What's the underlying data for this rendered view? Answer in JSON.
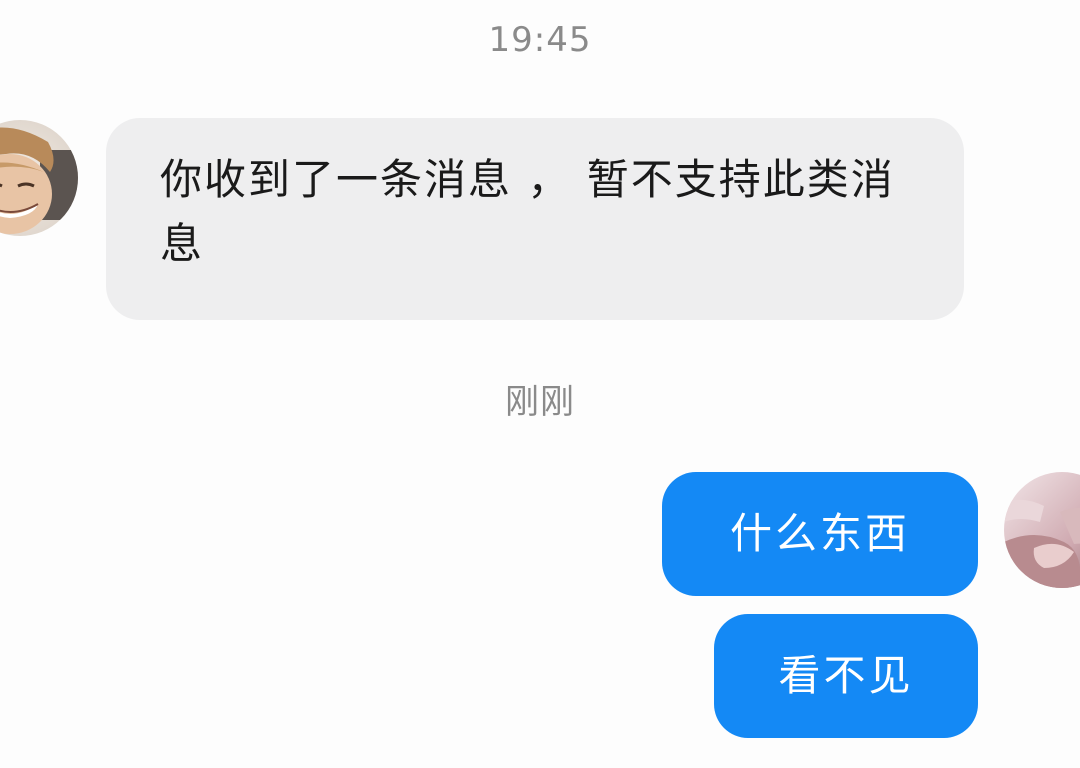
{
  "conversation": {
    "timestamp_top": "19:45",
    "timestamp_mid": "刚刚",
    "messages": [
      {
        "sender": "contact",
        "text": "你收到了一条消息 ， 暂不支持此类消息"
      },
      {
        "sender": "me",
        "text": "什么东西"
      },
      {
        "sender": "me",
        "text": "看不见"
      }
    ]
  },
  "colors": {
    "incoming_bubble": "#eeeeef",
    "outgoing_bubble": "#1489f5",
    "timestamp_text": "#8a8a8a"
  },
  "icons": {
    "contact_avatar": "contact-avatar-photo",
    "my_avatar": "my-avatar-photo"
  }
}
